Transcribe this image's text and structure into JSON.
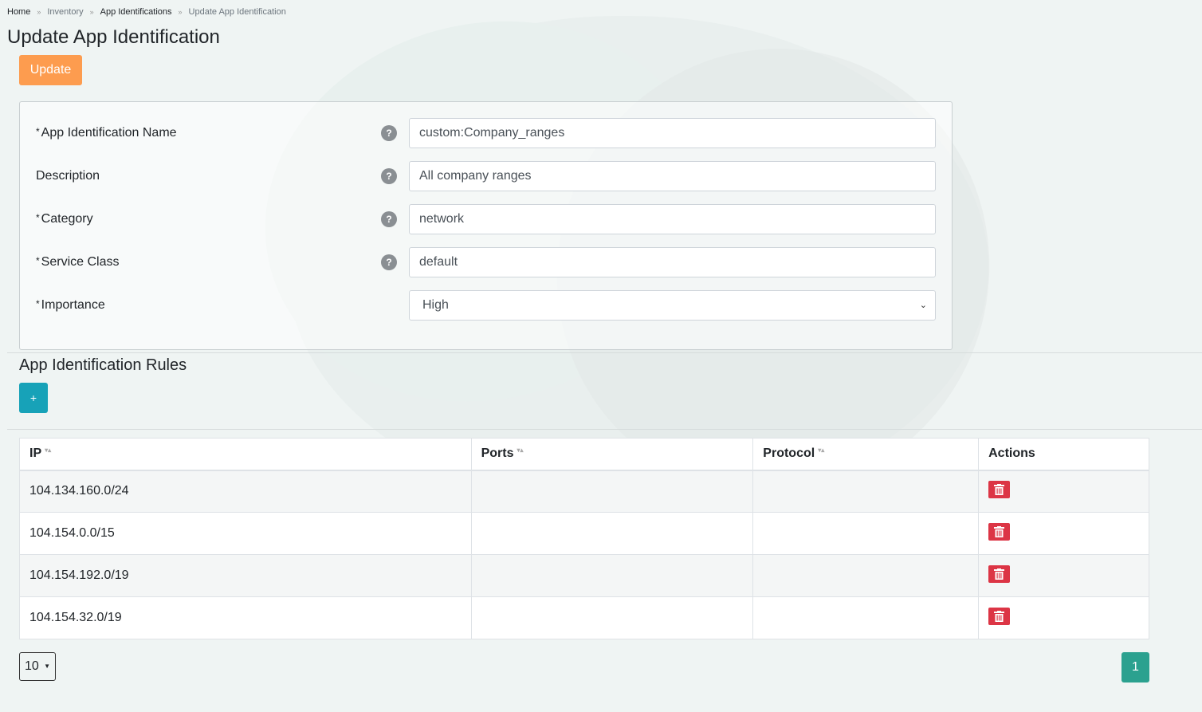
{
  "breadcrumb": {
    "home": "Home",
    "inventory": "Inventory",
    "app_identifications": "App Identifications",
    "current": "Update App Identification",
    "separator": "»"
  },
  "page_title": "Update App Identification",
  "update_button": "Update",
  "form": {
    "name": {
      "label": "App Identification Name",
      "required_mark": "*",
      "value": "custom:Company_ranges",
      "help": "?"
    },
    "description": {
      "label": "Description",
      "value": "All company ranges",
      "help": "?"
    },
    "category": {
      "label": "Category",
      "required_mark": "*",
      "value": "network",
      "help": "?"
    },
    "service_class": {
      "label": "Service Class",
      "required_mark": "*",
      "value": "default",
      "help": "?"
    },
    "importance": {
      "label": "Importance",
      "required_mark": "*",
      "selected": "High",
      "chevron": "⌄"
    }
  },
  "rules_section": {
    "title": "App Identification Rules",
    "add_button": "+"
  },
  "table": {
    "headers": {
      "ip": "IP",
      "ports": "Ports",
      "protocol": "Protocol",
      "actions": "Actions"
    },
    "sort_glyph": "▾▴",
    "rows": [
      {
        "ip": "104.134.160.0/24",
        "ports": "",
        "protocol": ""
      },
      {
        "ip": "104.154.0.0/15",
        "ports": "",
        "protocol": ""
      },
      {
        "ip": "104.154.192.0/19",
        "ports": "",
        "protocol": ""
      },
      {
        "ip": "104.154.32.0/19",
        "ports": "",
        "protocol": ""
      }
    ]
  },
  "pagination": {
    "page_size": "10",
    "current_page": "1"
  },
  "colors": {
    "update": "#fd9c4f",
    "add": "#17a2b8",
    "delete": "#dc3545",
    "page": "#2ba18f"
  }
}
